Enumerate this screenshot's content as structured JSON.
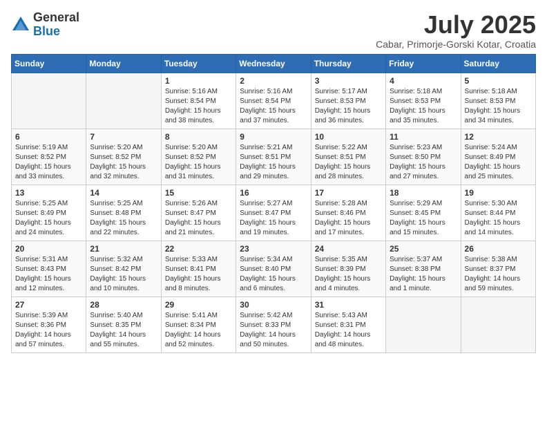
{
  "logo": {
    "general": "General",
    "blue": "Blue"
  },
  "title": "July 2025",
  "subtitle": "Cabar, Primorje-Gorski Kotar, Croatia",
  "days_of_week": [
    "Sunday",
    "Monday",
    "Tuesday",
    "Wednesday",
    "Thursday",
    "Friday",
    "Saturday"
  ],
  "weeks": [
    [
      {
        "day": "",
        "info": ""
      },
      {
        "day": "",
        "info": ""
      },
      {
        "day": "1",
        "info": "Sunrise: 5:16 AM\nSunset: 8:54 PM\nDaylight: 15 hours and 38 minutes."
      },
      {
        "day": "2",
        "info": "Sunrise: 5:16 AM\nSunset: 8:54 PM\nDaylight: 15 hours and 37 minutes."
      },
      {
        "day": "3",
        "info": "Sunrise: 5:17 AM\nSunset: 8:53 PM\nDaylight: 15 hours and 36 minutes."
      },
      {
        "day": "4",
        "info": "Sunrise: 5:18 AM\nSunset: 8:53 PM\nDaylight: 15 hours and 35 minutes."
      },
      {
        "day": "5",
        "info": "Sunrise: 5:18 AM\nSunset: 8:53 PM\nDaylight: 15 hours and 34 minutes."
      }
    ],
    [
      {
        "day": "6",
        "info": "Sunrise: 5:19 AM\nSunset: 8:52 PM\nDaylight: 15 hours and 33 minutes."
      },
      {
        "day": "7",
        "info": "Sunrise: 5:20 AM\nSunset: 8:52 PM\nDaylight: 15 hours and 32 minutes."
      },
      {
        "day": "8",
        "info": "Sunrise: 5:20 AM\nSunset: 8:52 PM\nDaylight: 15 hours and 31 minutes."
      },
      {
        "day": "9",
        "info": "Sunrise: 5:21 AM\nSunset: 8:51 PM\nDaylight: 15 hours and 29 minutes."
      },
      {
        "day": "10",
        "info": "Sunrise: 5:22 AM\nSunset: 8:51 PM\nDaylight: 15 hours and 28 minutes."
      },
      {
        "day": "11",
        "info": "Sunrise: 5:23 AM\nSunset: 8:50 PM\nDaylight: 15 hours and 27 minutes."
      },
      {
        "day": "12",
        "info": "Sunrise: 5:24 AM\nSunset: 8:49 PM\nDaylight: 15 hours and 25 minutes."
      }
    ],
    [
      {
        "day": "13",
        "info": "Sunrise: 5:25 AM\nSunset: 8:49 PM\nDaylight: 15 hours and 24 minutes."
      },
      {
        "day": "14",
        "info": "Sunrise: 5:25 AM\nSunset: 8:48 PM\nDaylight: 15 hours and 22 minutes."
      },
      {
        "day": "15",
        "info": "Sunrise: 5:26 AM\nSunset: 8:47 PM\nDaylight: 15 hours and 21 minutes."
      },
      {
        "day": "16",
        "info": "Sunrise: 5:27 AM\nSunset: 8:47 PM\nDaylight: 15 hours and 19 minutes."
      },
      {
        "day": "17",
        "info": "Sunrise: 5:28 AM\nSunset: 8:46 PM\nDaylight: 15 hours and 17 minutes."
      },
      {
        "day": "18",
        "info": "Sunrise: 5:29 AM\nSunset: 8:45 PM\nDaylight: 15 hours and 15 minutes."
      },
      {
        "day": "19",
        "info": "Sunrise: 5:30 AM\nSunset: 8:44 PM\nDaylight: 15 hours and 14 minutes."
      }
    ],
    [
      {
        "day": "20",
        "info": "Sunrise: 5:31 AM\nSunset: 8:43 PM\nDaylight: 15 hours and 12 minutes."
      },
      {
        "day": "21",
        "info": "Sunrise: 5:32 AM\nSunset: 8:42 PM\nDaylight: 15 hours and 10 minutes."
      },
      {
        "day": "22",
        "info": "Sunrise: 5:33 AM\nSunset: 8:41 PM\nDaylight: 15 hours and 8 minutes."
      },
      {
        "day": "23",
        "info": "Sunrise: 5:34 AM\nSunset: 8:40 PM\nDaylight: 15 hours and 6 minutes."
      },
      {
        "day": "24",
        "info": "Sunrise: 5:35 AM\nSunset: 8:39 PM\nDaylight: 15 hours and 4 minutes."
      },
      {
        "day": "25",
        "info": "Sunrise: 5:37 AM\nSunset: 8:38 PM\nDaylight: 15 hours and 1 minute."
      },
      {
        "day": "26",
        "info": "Sunrise: 5:38 AM\nSunset: 8:37 PM\nDaylight: 14 hours and 59 minutes."
      }
    ],
    [
      {
        "day": "27",
        "info": "Sunrise: 5:39 AM\nSunset: 8:36 PM\nDaylight: 14 hours and 57 minutes."
      },
      {
        "day": "28",
        "info": "Sunrise: 5:40 AM\nSunset: 8:35 PM\nDaylight: 14 hours and 55 minutes."
      },
      {
        "day": "29",
        "info": "Sunrise: 5:41 AM\nSunset: 8:34 PM\nDaylight: 14 hours and 52 minutes."
      },
      {
        "day": "30",
        "info": "Sunrise: 5:42 AM\nSunset: 8:33 PM\nDaylight: 14 hours and 50 minutes."
      },
      {
        "day": "31",
        "info": "Sunrise: 5:43 AM\nSunset: 8:31 PM\nDaylight: 14 hours and 48 minutes."
      },
      {
        "day": "",
        "info": ""
      },
      {
        "day": "",
        "info": ""
      }
    ]
  ]
}
